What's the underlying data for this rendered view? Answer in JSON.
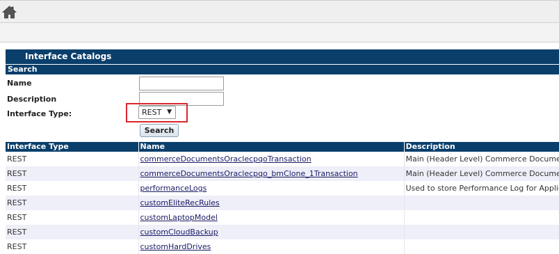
{
  "toolbar": {
    "home_icon": "home-icon"
  },
  "catalog": {
    "title": "Interface Catalogs"
  },
  "search": {
    "section_title": "Search",
    "name_label": "Name",
    "name_value": "",
    "description_label": "Description",
    "description_value": "",
    "interface_type_label": "Interface Type:",
    "interface_type_value": "REST",
    "search_button": "Search"
  },
  "results": {
    "columns": [
      "Interface Type",
      "Name",
      "Description"
    ],
    "rows": [
      {
        "type": "REST",
        "name": "commerceDocumentsOraclecpqoTransaction",
        "description": "Main (Header Level) Commerce Document - se"
      },
      {
        "type": "REST",
        "name": "commerceDocumentsOraclecpqo_bmClone_1Transaction",
        "description": "Main (Header Level) Commerce Document - se"
      },
      {
        "type": "REST",
        "name": "performanceLogs",
        "description": "Used to store Performance Log for Application"
      },
      {
        "type": "REST",
        "name": "customEliteRecRules",
        "description": ""
      },
      {
        "type": "REST",
        "name": "customLaptopModel",
        "description": ""
      },
      {
        "type": "REST",
        "name": "customCloudBackup",
        "description": ""
      },
      {
        "type": "REST",
        "name": "customHardDrives",
        "description": ""
      }
    ]
  }
}
